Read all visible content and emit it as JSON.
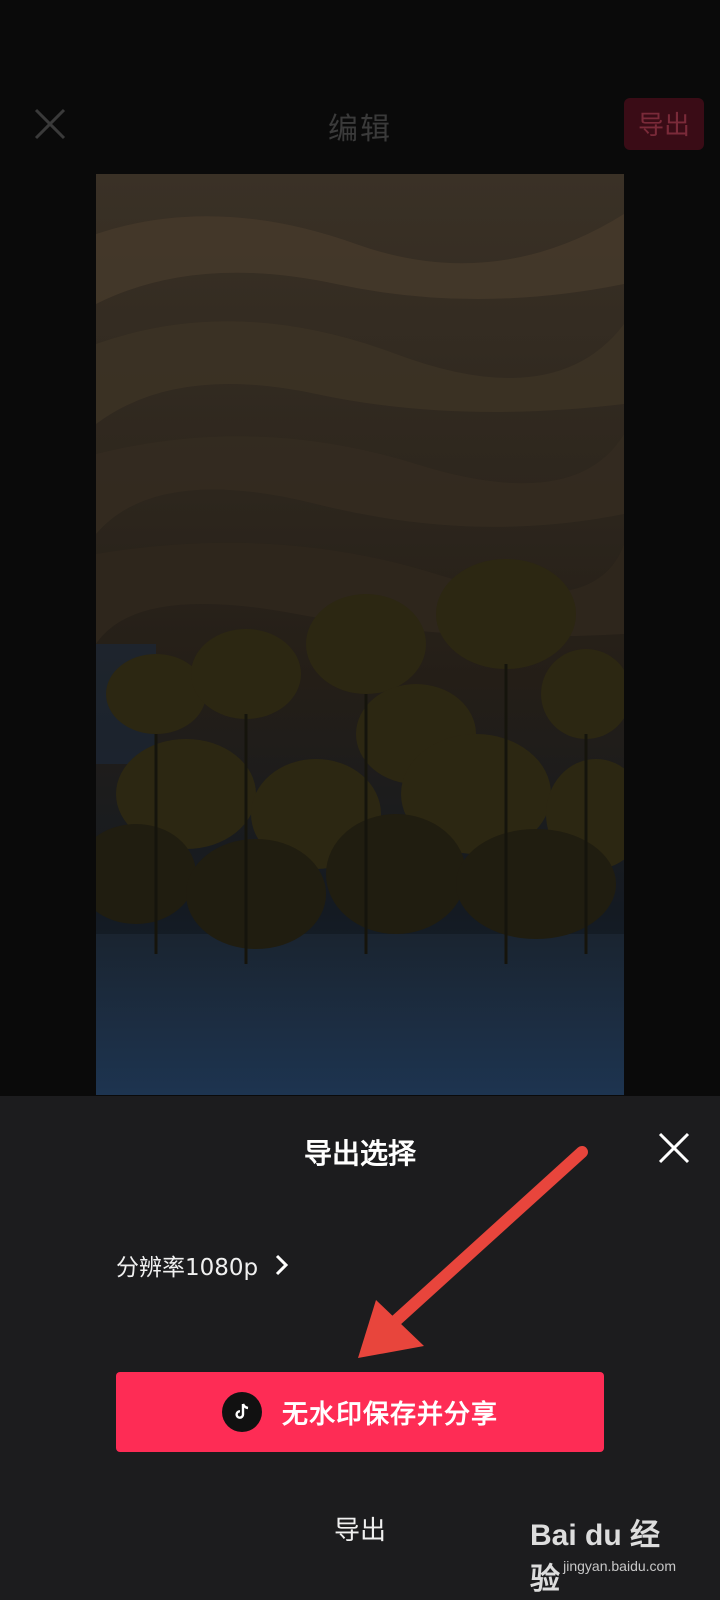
{
  "header": {
    "title": "编辑",
    "export_label": "导出"
  },
  "sheet": {
    "title": "导出选择",
    "resolution_label": "分辨率1080p",
    "share_button_label": "无水印保存并分享",
    "export_label": "导出"
  },
  "watermark": {
    "logo_text": "Bai du 经验",
    "url": "jingyan.baidu.com"
  },
  "colors": {
    "accent": "#fe2c55",
    "sheet_background": "#1c1c1e",
    "annotation_arrow": "#e8453c"
  },
  "icons": [
    "close-icon",
    "chevron-right-icon",
    "tiktok-icon",
    "annotation-arrow"
  ]
}
